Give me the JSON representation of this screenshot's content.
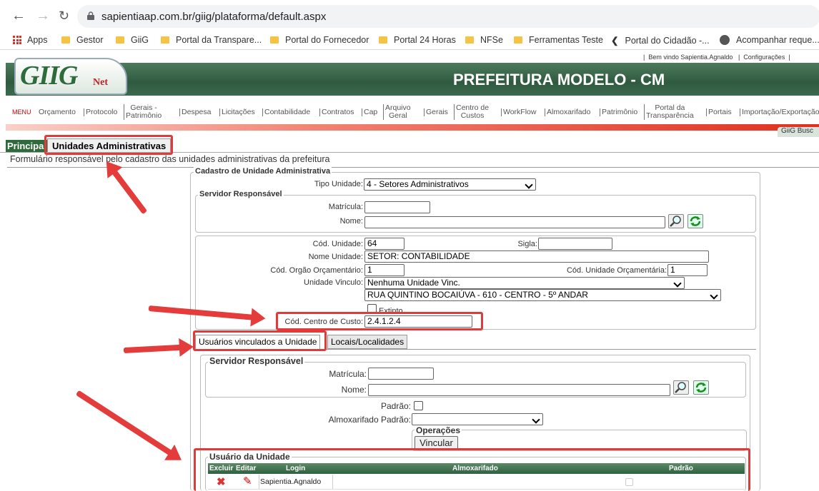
{
  "browser": {
    "url": "sapientiaap.com.br/giig/plataforma/default.aspx",
    "bookmarks": [
      "Apps",
      "Gestor",
      "GiiG",
      "Portal da Transpare...",
      "Portal do Fornecedor",
      "Portal 24 Horas",
      "NFSe",
      "Ferramentas Teste",
      "Portal do Cidadão -...",
      "Acompanhar reque..."
    ]
  },
  "header": {
    "welcome": "Bem vindo Sapientia.Agnaldo",
    "config": "Configurações",
    "logo_main": "GIIG",
    "logo_sub": "Net",
    "org_title": "PREFEITURA MODELO - CM",
    "gbusca": "GiiG Busc"
  },
  "menu": {
    "label": "MENU",
    "items": [
      "Orçamento",
      "Protocolo",
      "Gerais -\nPatrimônio",
      "Despesa",
      "Licitações",
      "Contabilidade",
      "Contratos",
      "Cap",
      "Arquivo\nGeral",
      "Gerais",
      "Centro de\nCustos",
      "WorkFlow",
      "Almoxarifado",
      "Patrimônio",
      "Portal da\nTransparência",
      "Portais",
      "Importação/Exportação"
    ]
  },
  "tabs": {
    "principal": "Principal",
    "current": "Unidades Administrativas"
  },
  "description": "Formulário responsável pelo cadastro das unidades administrativas da prefeitura",
  "form": {
    "legend": "Cadastro de Unidade Administrativa",
    "tipo_label": "Tipo Unidade:",
    "tipo_value": "4 - Setores Administrativos",
    "servidor_legend": "Servidor Responsável",
    "matricula_label": "Matrícula:",
    "nome_label": "Nome:",
    "cod_unidade_label": "Cód. Unidade:",
    "cod_unidade_value": "64",
    "sigla_label": "Sigla:",
    "nome_unidade_label": "Nome Unidade:",
    "nome_unidade_value": "SETOR: CONTABILIDADE",
    "cod_orgao_label": "Cód. Orgão Orçamentário:",
    "cod_orgao_value": "1",
    "cod_unid_orc_label": "Cód. Unidade Orçamentária:",
    "cod_unid_orc_value": "1",
    "vinculo_label": "Unidade Vinculo:",
    "vinculo_value": "Nenhuma Unidade Vinc.",
    "endereco_value": "RUA QUINTINO BOCAIÚVA - 610 - CENTRO - 5º ANDAR",
    "extinto_label": "Extinto",
    "centro_custo_label": "Cód. Centro de Custo:",
    "centro_custo_value": "2.4.1.2.4"
  },
  "inner_tabs": {
    "usuarios": "Usuários vinculados a Unidade",
    "locais": "Locais/Localidades"
  },
  "usuarios": {
    "servidor_legend": "Servidor Responsável",
    "matricula_label": "Matrícula:",
    "nome_label": "Nome:",
    "padrao_label": "Padrão:",
    "almox_label": "Almoxarifado Padrão:",
    "operacoes_legend": "Operações",
    "vincular_label": "Vincular",
    "grid_legend": "Usuário da Unidade",
    "columns": [
      "Excluir",
      "Editar",
      "Login",
      "Almoxarifado",
      "Padrão"
    ],
    "rows": [
      {
        "login": "Sapientia.Agnaldo",
        "almoxarifado": "",
        "padrao": false
      }
    ]
  }
}
